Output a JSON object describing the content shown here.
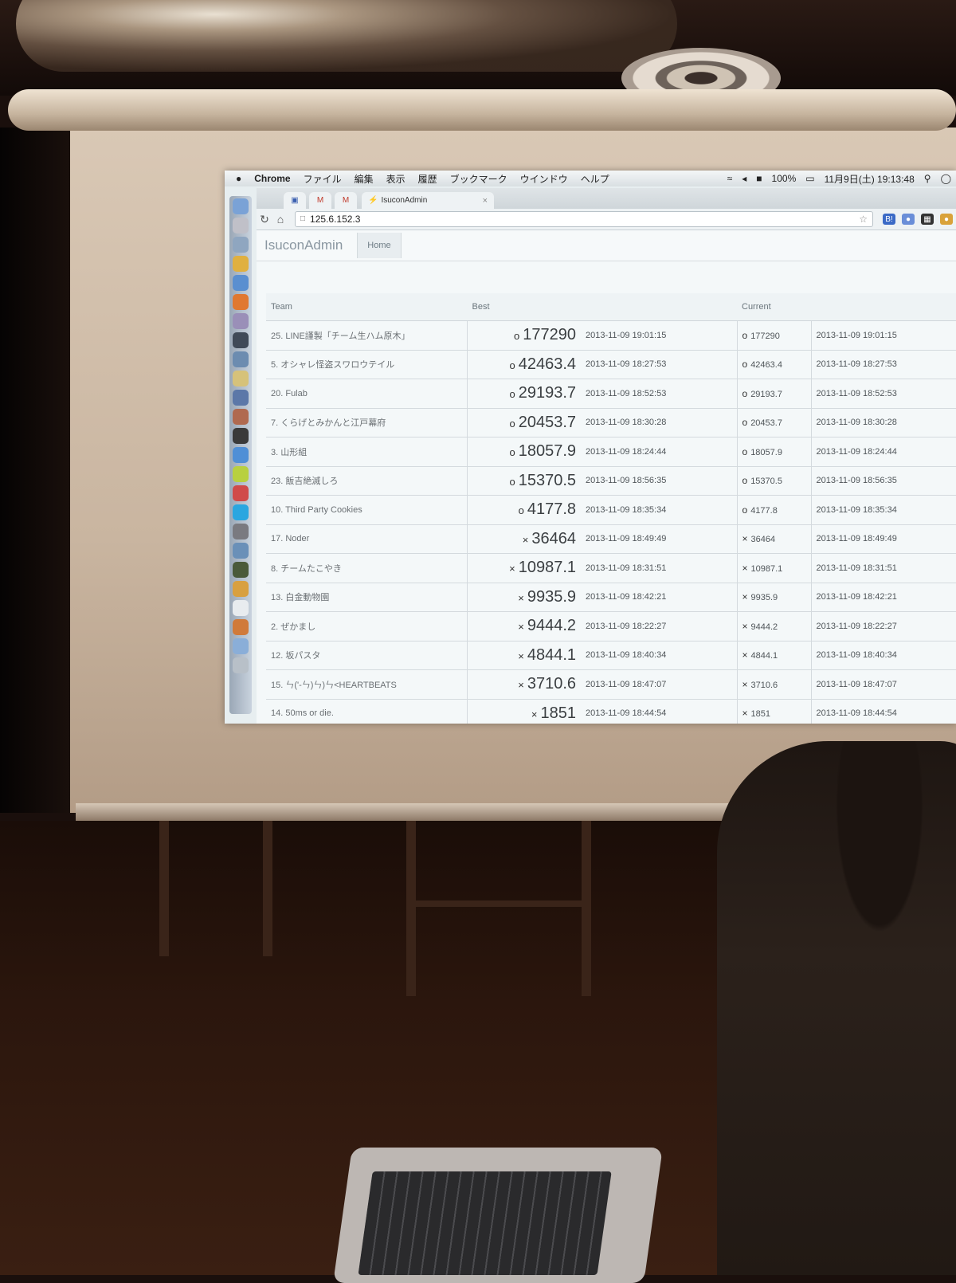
{
  "menubar": {
    "app": "Chrome",
    "items": [
      "ファイル",
      "編集",
      "表示",
      "履歴",
      "ブックマーク",
      "ウインドウ",
      "ヘルプ"
    ],
    "battery": "100%",
    "datetime": "11月9日(土) 19:13:48"
  },
  "browser": {
    "active_tab": "IsuconAdmin",
    "url": "125.6.152.3"
  },
  "app": {
    "brand": "IsuconAdmin",
    "nav_home": "Home"
  },
  "table": {
    "headers": {
      "team": "Team",
      "best": "Best",
      "current": "Current"
    },
    "rows": [
      {
        "team": "25. LINE謹製「チーム生ハム原木」",
        "mark": "o",
        "best": "177290",
        "best_time": "2013-11-09 19:01:15",
        "current": "177290",
        "current_time": "2013-11-09 19:01:15"
      },
      {
        "team": "5. オシャレ怪盗スワロウテイル",
        "mark": "o",
        "best": "42463.4",
        "best_time": "2013-11-09 18:27:53",
        "current": "42463.4",
        "current_time": "2013-11-09 18:27:53"
      },
      {
        "team": "20. Fulab",
        "mark": "o",
        "best": "29193.7",
        "best_time": "2013-11-09 18:52:53",
        "current": "29193.7",
        "current_time": "2013-11-09 18:52:53"
      },
      {
        "team": "7. くらげとみかんと江戸幕府",
        "mark": "o",
        "best": "20453.7",
        "best_time": "2013-11-09 18:30:28",
        "current": "20453.7",
        "current_time": "2013-11-09 18:30:28"
      },
      {
        "team": "3. 山形組",
        "mark": "o",
        "best": "18057.9",
        "best_time": "2013-11-09 18:24:44",
        "current": "18057.9",
        "current_time": "2013-11-09 18:24:44"
      },
      {
        "team": "23. 飯吉絶滅しろ",
        "mark": "o",
        "best": "15370.5",
        "best_time": "2013-11-09 18:56:35",
        "current": "15370.5",
        "current_time": "2013-11-09 18:56:35"
      },
      {
        "team": "10. Third Party Cookies",
        "mark": "o",
        "best": "4177.8",
        "best_time": "2013-11-09 18:35:34",
        "current": "4177.8",
        "current_time": "2013-11-09 18:35:34"
      },
      {
        "team": "17. Noder",
        "mark": "×",
        "best": "36464",
        "best_time": "2013-11-09 18:49:49",
        "current": "36464",
        "current_time": "2013-11-09 18:49:49"
      },
      {
        "team": "8. チームたこやき",
        "mark": "×",
        "best": "10987.1",
        "best_time": "2013-11-09 18:31:51",
        "current": "10987.1",
        "current_time": "2013-11-09 18:31:51"
      },
      {
        "team": "13. 白金動物園",
        "mark": "×",
        "best": "9935.9",
        "best_time": "2013-11-09 18:42:21",
        "current": "9935.9",
        "current_time": "2013-11-09 18:42:21"
      },
      {
        "team": "2. ぜかまし",
        "mark": "×",
        "best": "9444.2",
        "best_time": "2013-11-09 18:22:27",
        "current": "9444.2",
        "current_time": "2013-11-09 18:22:27"
      },
      {
        "team": "12. 坂パスタ",
        "mark": "×",
        "best": "4844.1",
        "best_time": "2013-11-09 18:40:34",
        "current": "4844.1",
        "current_time": "2013-11-09 18:40:34"
      },
      {
        "team": "15. ㄣ('-ㄣ)ㄣ)ㄣ<HEARTBEATS",
        "mark": "×",
        "best": "3710.6",
        "best_time": "2013-11-09 18:47:07",
        "current": "3710.6",
        "current_time": "2013-11-09 18:47:07"
      },
      {
        "team": "14. 50ms or die.",
        "mark": "×",
        "best": "1851",
        "best_time": "2013-11-09 18:44:54",
        "current": "1851",
        "current_time": "2013-11-09 18:44:54"
      }
    ]
  },
  "colors": {
    "screen_background": "#e7eef0",
    "room": "#1a0f0c"
  }
}
